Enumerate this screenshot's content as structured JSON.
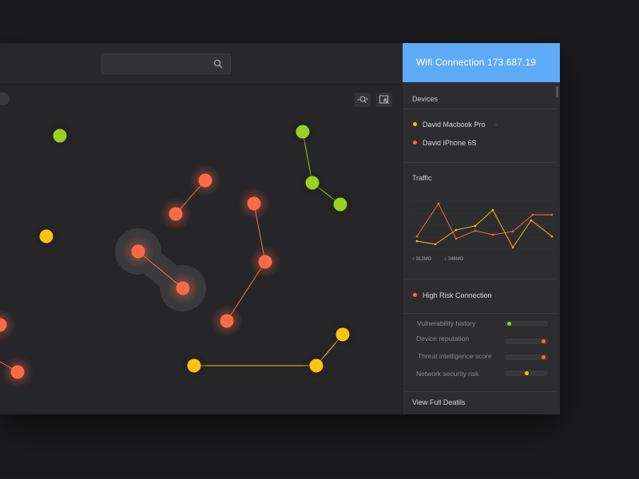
{
  "search": {
    "value": ""
  },
  "tools": {
    "zoom_icon": "zoom-out-icon",
    "select_icon": "select-area-icon"
  },
  "colors": {
    "accent": "#5eaaf8",
    "orange": "#ff6a45",
    "green": "#9ad11f",
    "yellow": "#ffc20e"
  },
  "panel": {
    "title": "Wifi Connection 173.687.19",
    "devices_title": "Devices",
    "devices": [
      {
        "label": "David Macbook Pro",
        "suffix": "·",
        "color": "#ffc20e"
      },
      {
        "label": "David IPhone 6S",
        "suffix": "",
        "color": "#ff6a45"
      }
    ],
    "traffic_title": "Traffic",
    "upload": "↑ 312MG",
    "download": "↓ 346MG",
    "high_risk_title": "High Risk Connection",
    "risks": [
      {
        "label": "Vulnerability history",
        "level": 0.05,
        "color": "#9ad11f"
      },
      {
        "label": "Device reputation",
        "level": 0.95,
        "color": "#ff6a45"
      },
      {
        "label": "Threat intelligence score",
        "level": 0.95,
        "color": "#ff6a45"
      },
      {
        "label": "Network security risk",
        "level": 0.5,
        "color": "#ffc20e"
      }
    ],
    "footer_link": "View Full Deatils"
  }
}
